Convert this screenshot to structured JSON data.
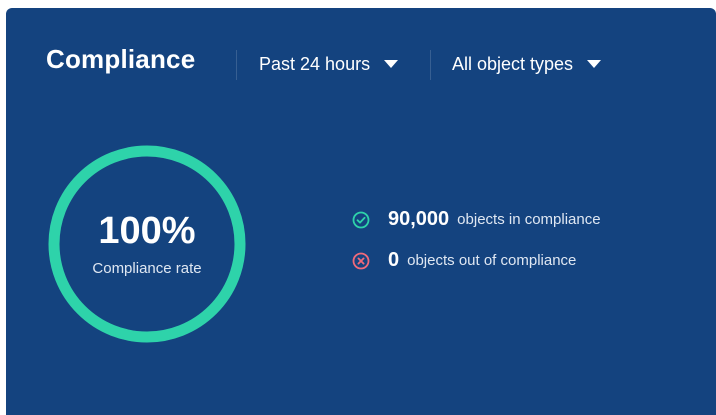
{
  "header": {
    "title": "Compliance",
    "time_filter": "Past 24 hours",
    "type_filter": "All object types"
  },
  "summary": {
    "rate_value": "100%",
    "rate_label": "Compliance rate",
    "rate_fraction": 1.0
  },
  "stats": [
    {
      "number": "90,000",
      "text": "objects in compliance",
      "icon": "check-circle-icon"
    },
    {
      "number": "0",
      "text": "objects out of compliance",
      "icon": "x-circle-icon"
    }
  ],
  "colors": {
    "background": "#14437f",
    "accent": "#2ed3aa",
    "error": "#f06a7a",
    "text": "#ffffff"
  }
}
